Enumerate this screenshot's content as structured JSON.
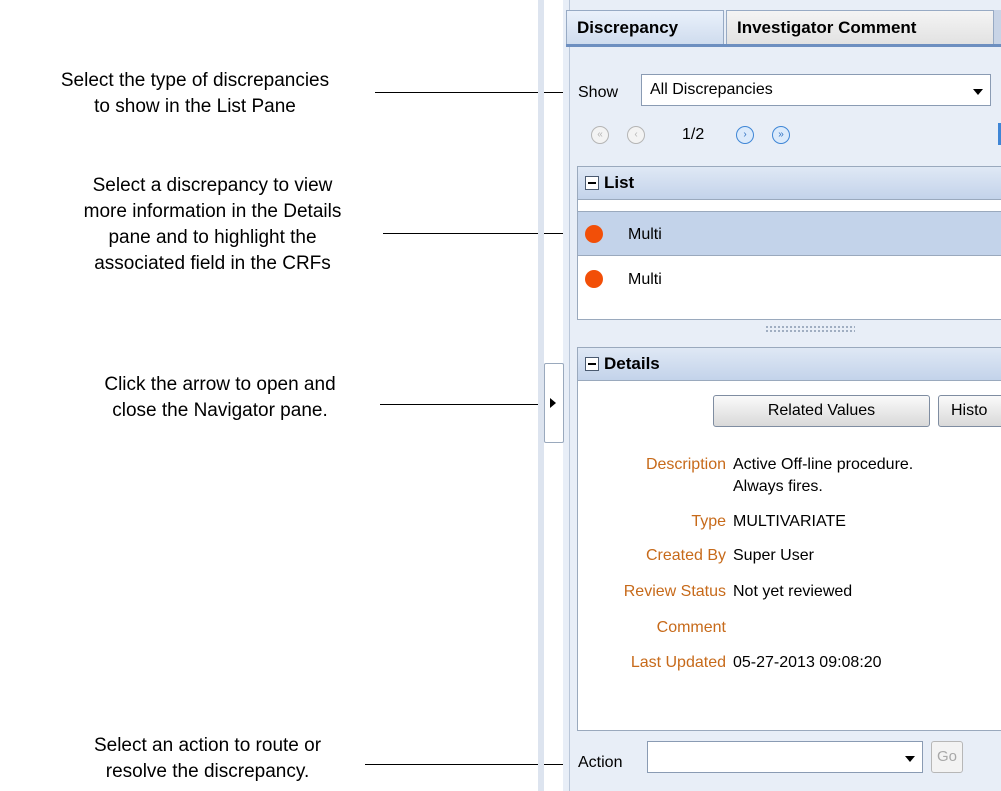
{
  "callouts": {
    "show_filter": [
      "Select the type of discrepancies",
      "to show in the List Pane"
    ],
    "list": [
      "Select a discrepancy to view",
      "more information in the Details",
      "pane and to highlight the",
      "associated field in the CRFs"
    ],
    "navigator": [
      "Click the arrow to open and",
      "close the Navigator pane."
    ],
    "action": [
      "Select an action to route or",
      "resolve the discrepancy."
    ]
  },
  "tabs": [
    {
      "label": "Discrepancy",
      "active": true
    },
    {
      "label": "Investigator Comment",
      "active": false
    }
  ],
  "show": {
    "label": "Show",
    "value": "All Discrepancies"
  },
  "pager": {
    "page": "1/2",
    "first": "«",
    "prev": "‹",
    "next": "›",
    "last": "»"
  },
  "list": {
    "title": "List",
    "items": [
      {
        "label": "Multi",
        "selected": true,
        "status_color": "#f24f08"
      },
      {
        "label": "Multi",
        "selected": false,
        "status_color": "#f24f08"
      }
    ]
  },
  "details": {
    "title": "Details",
    "buttons": [
      "Related Values",
      "Histo"
    ],
    "fields": [
      {
        "label": "Description",
        "value": "Active Off-line procedure.",
        "value2": "Always fires."
      },
      {
        "label": "Type",
        "value": "MULTIVARIATE"
      },
      {
        "label": "Created By",
        "value": "Super User"
      },
      {
        "label": "Review Status",
        "value": "Not yet reviewed"
      },
      {
        "label": "Comment",
        "value": ""
      },
      {
        "label": "Last Updated",
        "value": "05-27-2013 09:08:20"
      }
    ]
  },
  "action": {
    "label": "Action",
    "value": "",
    "go_label": "Go"
  },
  "icons": {
    "collapse": "minus-box-icon",
    "navigator_toggle": "right-arrow-icon",
    "dropdown": "chevron-down-icon"
  }
}
